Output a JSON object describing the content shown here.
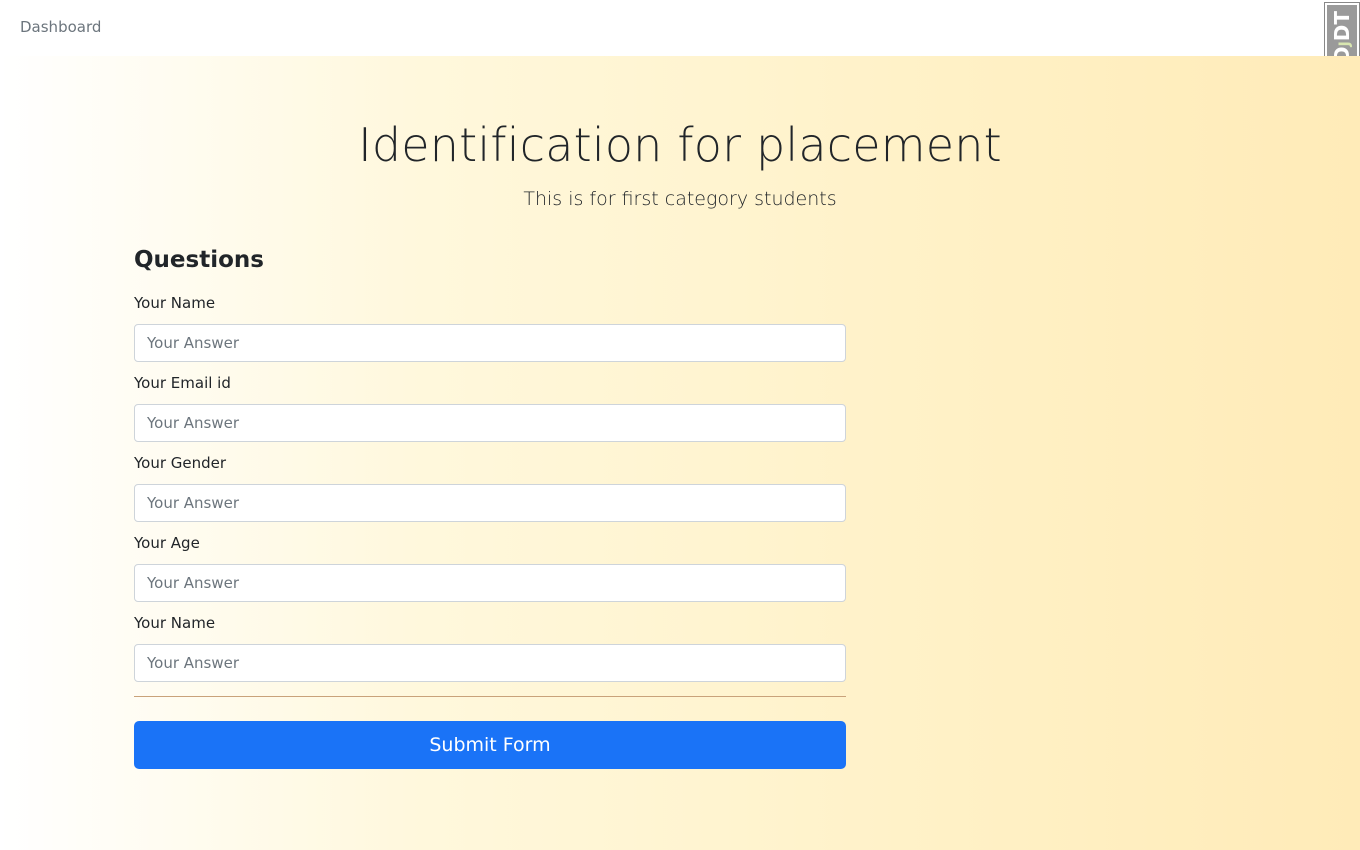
{
  "nav": {
    "dashboard_label": "Dashboard"
  },
  "debug_toolbar": {
    "label_d": "D",
    "label_j": "J",
    "label_dt": "DT"
  },
  "header": {
    "title": "Identification for placement",
    "subtitle": "This is for first category students"
  },
  "form": {
    "section_heading": "Questions",
    "fields": [
      {
        "label": "Your Name",
        "placeholder": "Your Answer",
        "value": ""
      },
      {
        "label": "Your Email id",
        "placeholder": "Your Answer",
        "value": ""
      },
      {
        "label": "Your Gender",
        "placeholder": "Your Answer",
        "value": ""
      },
      {
        "label": "Your Age",
        "placeholder": "Your Answer",
        "value": ""
      },
      {
        "label": "Your Name",
        "placeholder": "Your Answer",
        "value": ""
      }
    ],
    "submit_label": "Submit Form"
  },
  "colors": {
    "primary_button": "#1a73f7",
    "gradient_start": "#ffffff",
    "gradient_end": "#ffebb8"
  }
}
